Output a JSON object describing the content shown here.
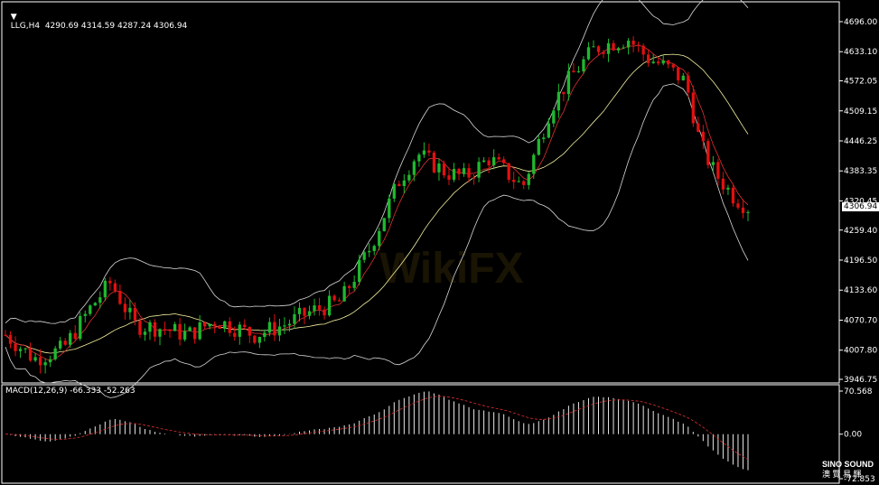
{
  "chart_data": {
    "type": "candlestick",
    "symbol_header": "LLG,H4  4290.69 4314.59 4287.24 4306.94",
    "current_price_label": "4306.94",
    "price_axis": {
      "ticks": [
        "4696.00",
        "4633.10",
        "4572.05",
        "4509.15",
        "4446.25",
        "4383.35",
        "4320.45",
        "4259.40",
        "4196.50",
        "4133.60",
        "4070.70",
        "4007.80",
        "3946.75"
      ],
      "ylim": [
        3946.75,
        4696.0
      ]
    },
    "macd": {
      "label": "MACD(12,26,9) -66.333 -52.263",
      "ticks": [
        "70.568",
        "0.00",
        "-72.853"
      ],
      "ylim": [
        -72.853,
        70.568
      ]
    },
    "colors": {
      "up": "#1fb82f",
      "down": "#e01010",
      "bands": "#d8d8d8",
      "mid": "#f4f0a0",
      "signal": "#e03030",
      "hist": "#e8e8e8",
      "grid": "#ffffff"
    }
  },
  "watermark": {
    "brand": "WikiFX"
  },
  "logo": {
    "name": "SINO SOUND",
    "sub": "澳 覽 易 輝"
  }
}
